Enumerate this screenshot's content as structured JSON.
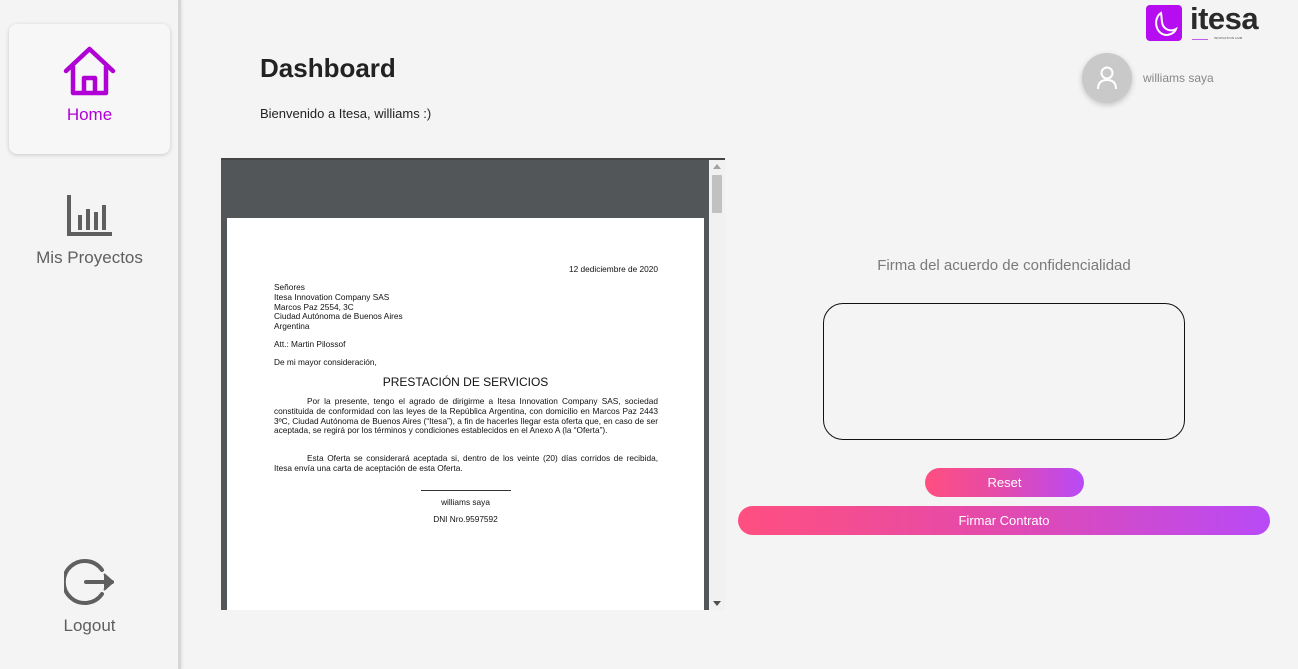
{
  "sidebar": {
    "items": [
      {
        "label": "Home",
        "icon": "home-icon",
        "active": true
      },
      {
        "label": "Mis Proyectos",
        "icon": "bar-chart-icon",
        "active": false
      },
      {
        "label": "Logout",
        "icon": "logout-icon",
        "active": false
      }
    ]
  },
  "header": {
    "title": "Dashboard",
    "welcome": "Bienvenido a Itesa, williams :)"
  },
  "brand": {
    "name": "itesa",
    "tagline": "INNOVATION HUB",
    "color": "#b60cf2"
  },
  "user": {
    "name": "williams saya",
    "avatar_icon": "user-icon"
  },
  "document": {
    "date": "12 dediciembre de 2020",
    "address_lines": [
      "Señores",
      "Itesa Innovation Company SAS",
      "Marcos Paz 2554, 3C",
      "Ciudad Autónoma de Buenos Aires",
      "Argentina"
    ],
    "att": "Att.: Martin Pilossof",
    "greeting": "De mi mayor consideración,",
    "title": "PRESTACIÓN DE SERVICIOS",
    "paragraph1": "Por la presente, tengo el agrado de dirigirme a Itesa Innovation Company SAS, sociedad constituida de conformidad con las leyes de la República Argentina, con domicilio en Marcos Paz 2443 3ºC, Ciudad Autónoma de Buenos Aires (“Itesa”), a fin de hacerles llegar esta oferta que, en caso de ser aceptada, se regirá por los términos y condiciones establecidos en el Anexo A (la “Oferta”).",
    "paragraph2": "Esta Oferta se considerará aceptada si, dentro de los veinte (20) días corridos de recibida, Itesa envía una carta de aceptación de esta Oferta.",
    "signer_name": "williams saya",
    "dni": "DNI Nro.9597592"
  },
  "signature": {
    "title": "Firma del acuerdo de confidencialidad",
    "reset_label": "Reset",
    "submit_label": "Firmar Contrato"
  },
  "colors": {
    "accent": "#b000d6",
    "button_gradient_start": "#ff4f80",
    "button_gradient_end": "#b84af7"
  }
}
